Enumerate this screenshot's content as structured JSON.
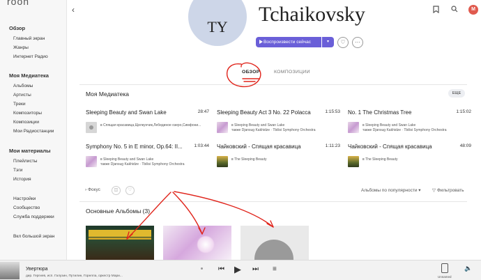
{
  "sidebar": {
    "logo": "roon",
    "sections": [
      {
        "title": "Обзор",
        "items": [
          "Главный экран",
          "Жанры",
          "Интернет Радио"
        ]
      },
      {
        "title": "Моя Медиатека",
        "items": [
          "Альбомы",
          "Артисты",
          "Треки",
          "Композиторы",
          "Композиции",
          "Мои Радиостанции"
        ]
      },
      {
        "title": "Мои материалы",
        "items": [
          "Плейлисты",
          "Тэги",
          "История"
        ]
      },
      {
        "title": "",
        "items": [
          "Настройки",
          "Сообщество",
          "Служба поддержки"
        ]
      },
      {
        "title": "",
        "items": [
          "Вкл большой экран"
        ]
      }
    ]
  },
  "header": {
    "back_icon": "chevron-left-icon",
    "bookmark_icon": "bookmark-icon",
    "search_icon": "search-icon",
    "user_initial": "M"
  },
  "artist": {
    "initials": "TY",
    "name": "Tchaikovsky",
    "play_label": "Воспроизвести сейчас"
  },
  "tabs": [
    "ОБЗОР",
    "КОМПОЗИЦИИ"
  ],
  "library": {
    "title": "Моя Медиатека",
    "more_label": "ЕЩЕ",
    "tracks": [
      {
        "title": "Sleeping Beauty and Swan Lake",
        "duration": "28:47",
        "sub1": "в Спящая красавица,Щелкунчик,Лебединое озеро,Симфони...",
        "sub2": "",
        "thumb": "grey"
      },
      {
        "title": "Sleeping Beauty Act 3 No. 22 Polacca",
        "duration": "1:15:53",
        "sub1": "в Sleeping Beauty and Swan Lake",
        "sub2": "также Djansug Kakhidze · Tbilisi Symphony Orchestra",
        "thumb": "ballet"
      },
      {
        "title": "No. 1 The Christmas Tree",
        "duration": "1:15:02",
        "sub1": "в Sleeping Beauty and Swan Lake",
        "sub2": "также Djansug Kakhidze · Tbilisi Symphony Orchestra",
        "thumb": "ballet"
      },
      {
        "title": "Symphony No. 5 in E minor, Op.64: II...",
        "duration": "1:03:44",
        "sub1": "в Sleeping Beauty and Swan Lake",
        "sub2": "также Djansug Kakhidze · Tbilisi Symphony Orchestra",
        "thumb": "ballet"
      },
      {
        "title": "Чайковский - Спящая красавица",
        "duration": "1:11:23",
        "sub1": "в The Sleeping Beauty",
        "sub2": "",
        "thumb": "gold"
      },
      {
        "title": "Чайковский - Спящая красавица",
        "duration": "48:09",
        "sub1": "в The Sleeping Beauty",
        "sub2": "",
        "thumb": "gold"
      }
    ]
  },
  "filters": {
    "focus_label": "Фокус",
    "sort_label": "Альбомы по популярности",
    "filter_label": "Фильтровать"
  },
  "albums": {
    "title": "Основные Альбомы (3)"
  },
  "player": {
    "title": "Увертюра",
    "subtitle": "дир. Гергиев, исп. Галузин, Путилин, Горелла, оркестр Мари...",
    "device_label": "Unnamed"
  },
  "colors": {
    "accent": "#6a5fd8",
    "annotation": "#e0241b",
    "artist_circle": "#cdd6e8",
    "avatar": "#e05a4e"
  }
}
